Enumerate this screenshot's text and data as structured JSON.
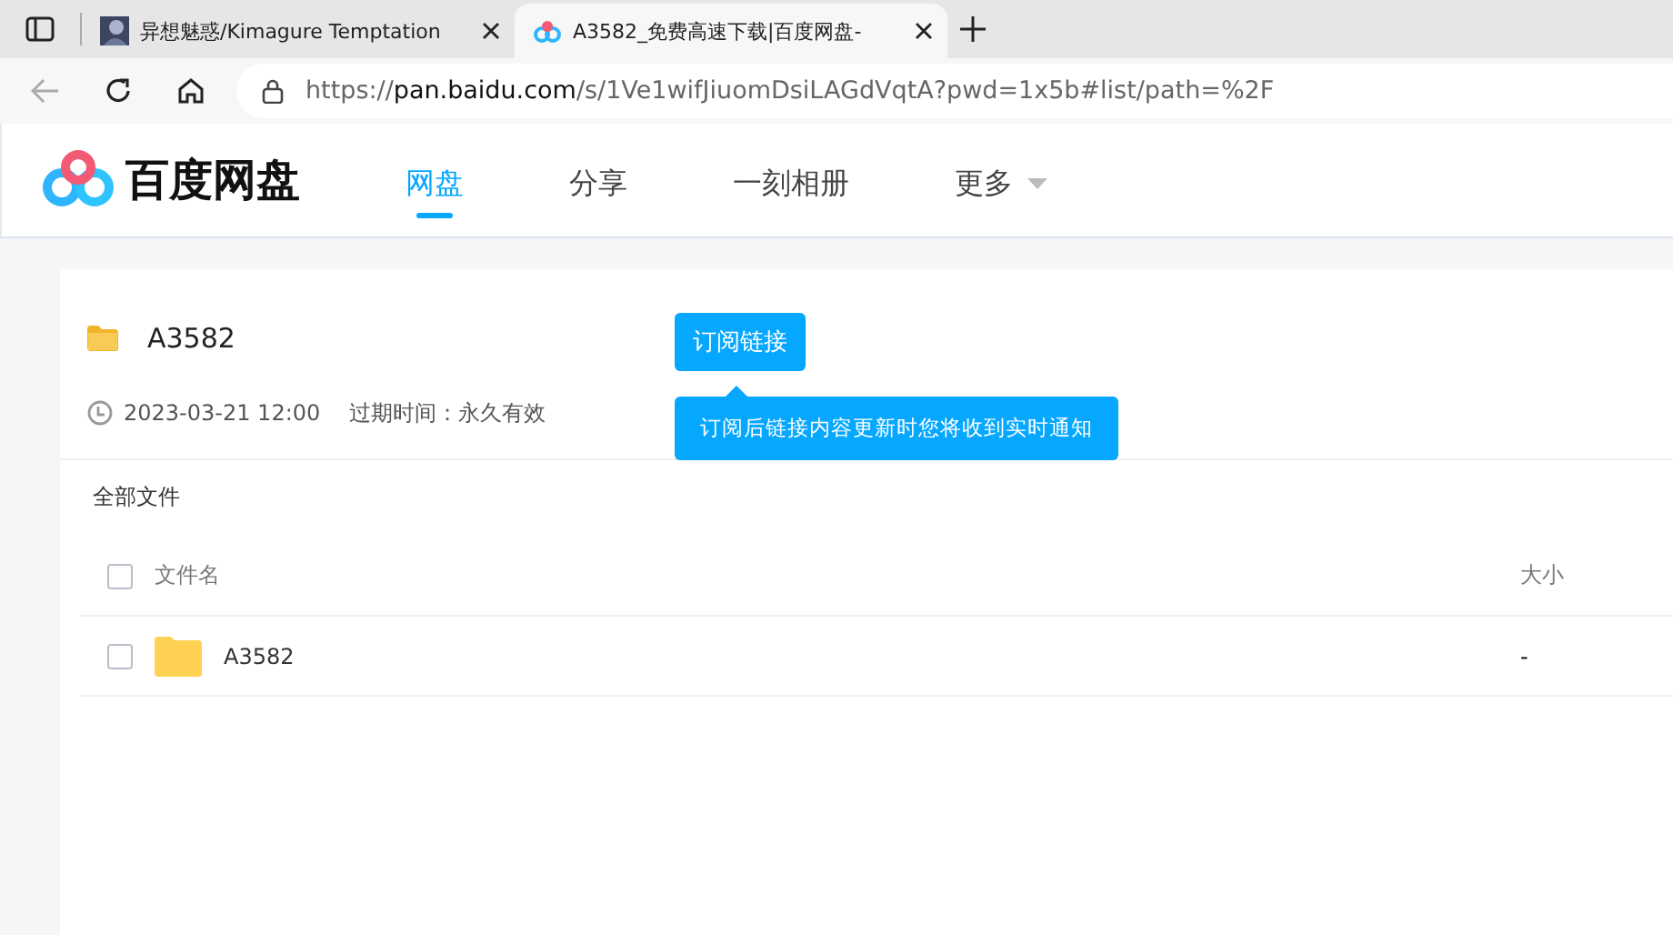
{
  "browser": {
    "tabs": [
      {
        "title": "异想魅惑/Kimagure Temptation",
        "selected": false
      },
      {
        "title": "A3582_免费高速下载|百度网盘-",
        "selected": true
      }
    ],
    "url": {
      "host": "pan.baidu.com",
      "prefix": "https://",
      "path": "/s/1Ve1wifJiuomDsiLAGdVqtA?pwd=1x5b#list/path=%2F"
    }
  },
  "site": {
    "logo": "百度网盘",
    "nav": [
      {
        "label": "网盘",
        "selected": true
      },
      {
        "label": "分享",
        "selected": false
      },
      {
        "label": "一刻相册",
        "selected": false
      },
      {
        "label": "更多",
        "selected": false
      }
    ]
  },
  "share": {
    "title": "A3582",
    "date": "2023-03-21 12:00",
    "expiry": "过期时间：永久有效",
    "subscribe": "订阅链接",
    "tooltip": "订阅后链接内容更新时您将收到实时通知"
  },
  "breadcrumb": "全部文件",
  "table": {
    "columns": [
      "文件名",
      "大小"
    ],
    "rows": [
      {
        "name": "A3582",
        "size": "-",
        "checked": false
      }
    ],
    "all_checked": false
  }
}
